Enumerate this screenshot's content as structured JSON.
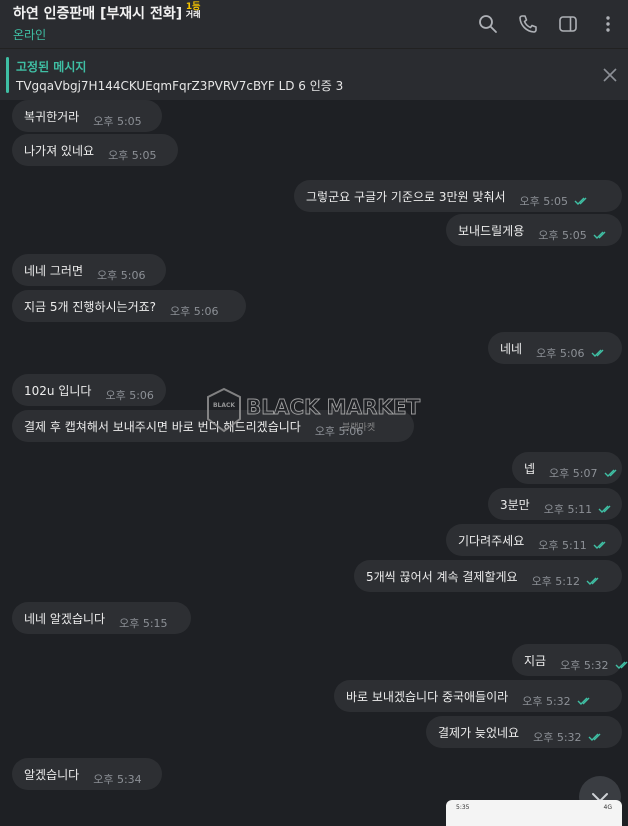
{
  "header": {
    "title": "하연 인증판매 [부재시 전화]",
    "badge_top": "1등",
    "badge_bottom": "거래",
    "status": "온라인",
    "icons": [
      "search-icon",
      "phone-icon",
      "sidebar-toggle-icon",
      "more-vert-icon"
    ]
  },
  "pinned": {
    "label": "고정된 메시지",
    "text": "TVgqaVbgj7H144CKUEqmFqrZ3PVRV7cBYF LD 6 인증 3"
  },
  "messages": [
    {
      "dir": "in",
      "text": "복귀한거라",
      "time": "오후 5:05"
    },
    {
      "dir": "in",
      "text": "나가져 있네요",
      "time": "오후 5:05"
    },
    {
      "dir": "out",
      "text": "그렇군요 구글가 기준으로 3만원 맞춰서",
      "time": "오후 5:05"
    },
    {
      "dir": "out",
      "text": "보내드릴게용",
      "time": "오후 5:05"
    },
    {
      "dir": "in",
      "text": "네네 그러면",
      "time": "오후 5:06"
    },
    {
      "dir": "in",
      "text": "지금 5개 진행하시는거죠?",
      "time": "오후 5:06"
    },
    {
      "dir": "out",
      "text": "네네",
      "time": "오후 5:06"
    },
    {
      "dir": "in",
      "text": "102u 입니다",
      "time": "오후 5:06"
    },
    {
      "dir": "in",
      "text": "결제 후 캡쳐해서 보내주시면 바로 번디 해드리겠습니다",
      "time": "오후 5:06"
    },
    {
      "dir": "out",
      "text": "넵",
      "time": "오후 5:07"
    },
    {
      "dir": "out",
      "text": "3분만",
      "time": "오후 5:11"
    },
    {
      "dir": "out",
      "text": "기다려주세요",
      "time": "오후 5:11"
    },
    {
      "dir": "out",
      "text": "5개씩 끊어서 계속 결제할게요",
      "time": "오후 5:12"
    },
    {
      "dir": "in",
      "text": "네네 알겠습니다",
      "time": "오후 5:15"
    },
    {
      "dir": "out",
      "text": "지금",
      "time": "오후 5:32"
    },
    {
      "dir": "out",
      "text": "바로 보내겠습니다 중국애들이라",
      "time": "오후 5:32"
    },
    {
      "dir": "out",
      "text": "결제가 늦었네요",
      "time": "오후 5:32"
    },
    {
      "dir": "in",
      "text": "알겠습니다",
      "time": "오후 5:34"
    }
  ],
  "watermark": {
    "text": "BLACK MARKET",
    "sub": "블랙마켓",
    "badge": "BLACK"
  },
  "preview": {
    "time": "5:35",
    "status": "4G"
  },
  "colors": {
    "accent": "#3fbfa4",
    "background": "#1e2024",
    "bubble": "#2d2f33",
    "ticks": "#3fbfa4"
  }
}
